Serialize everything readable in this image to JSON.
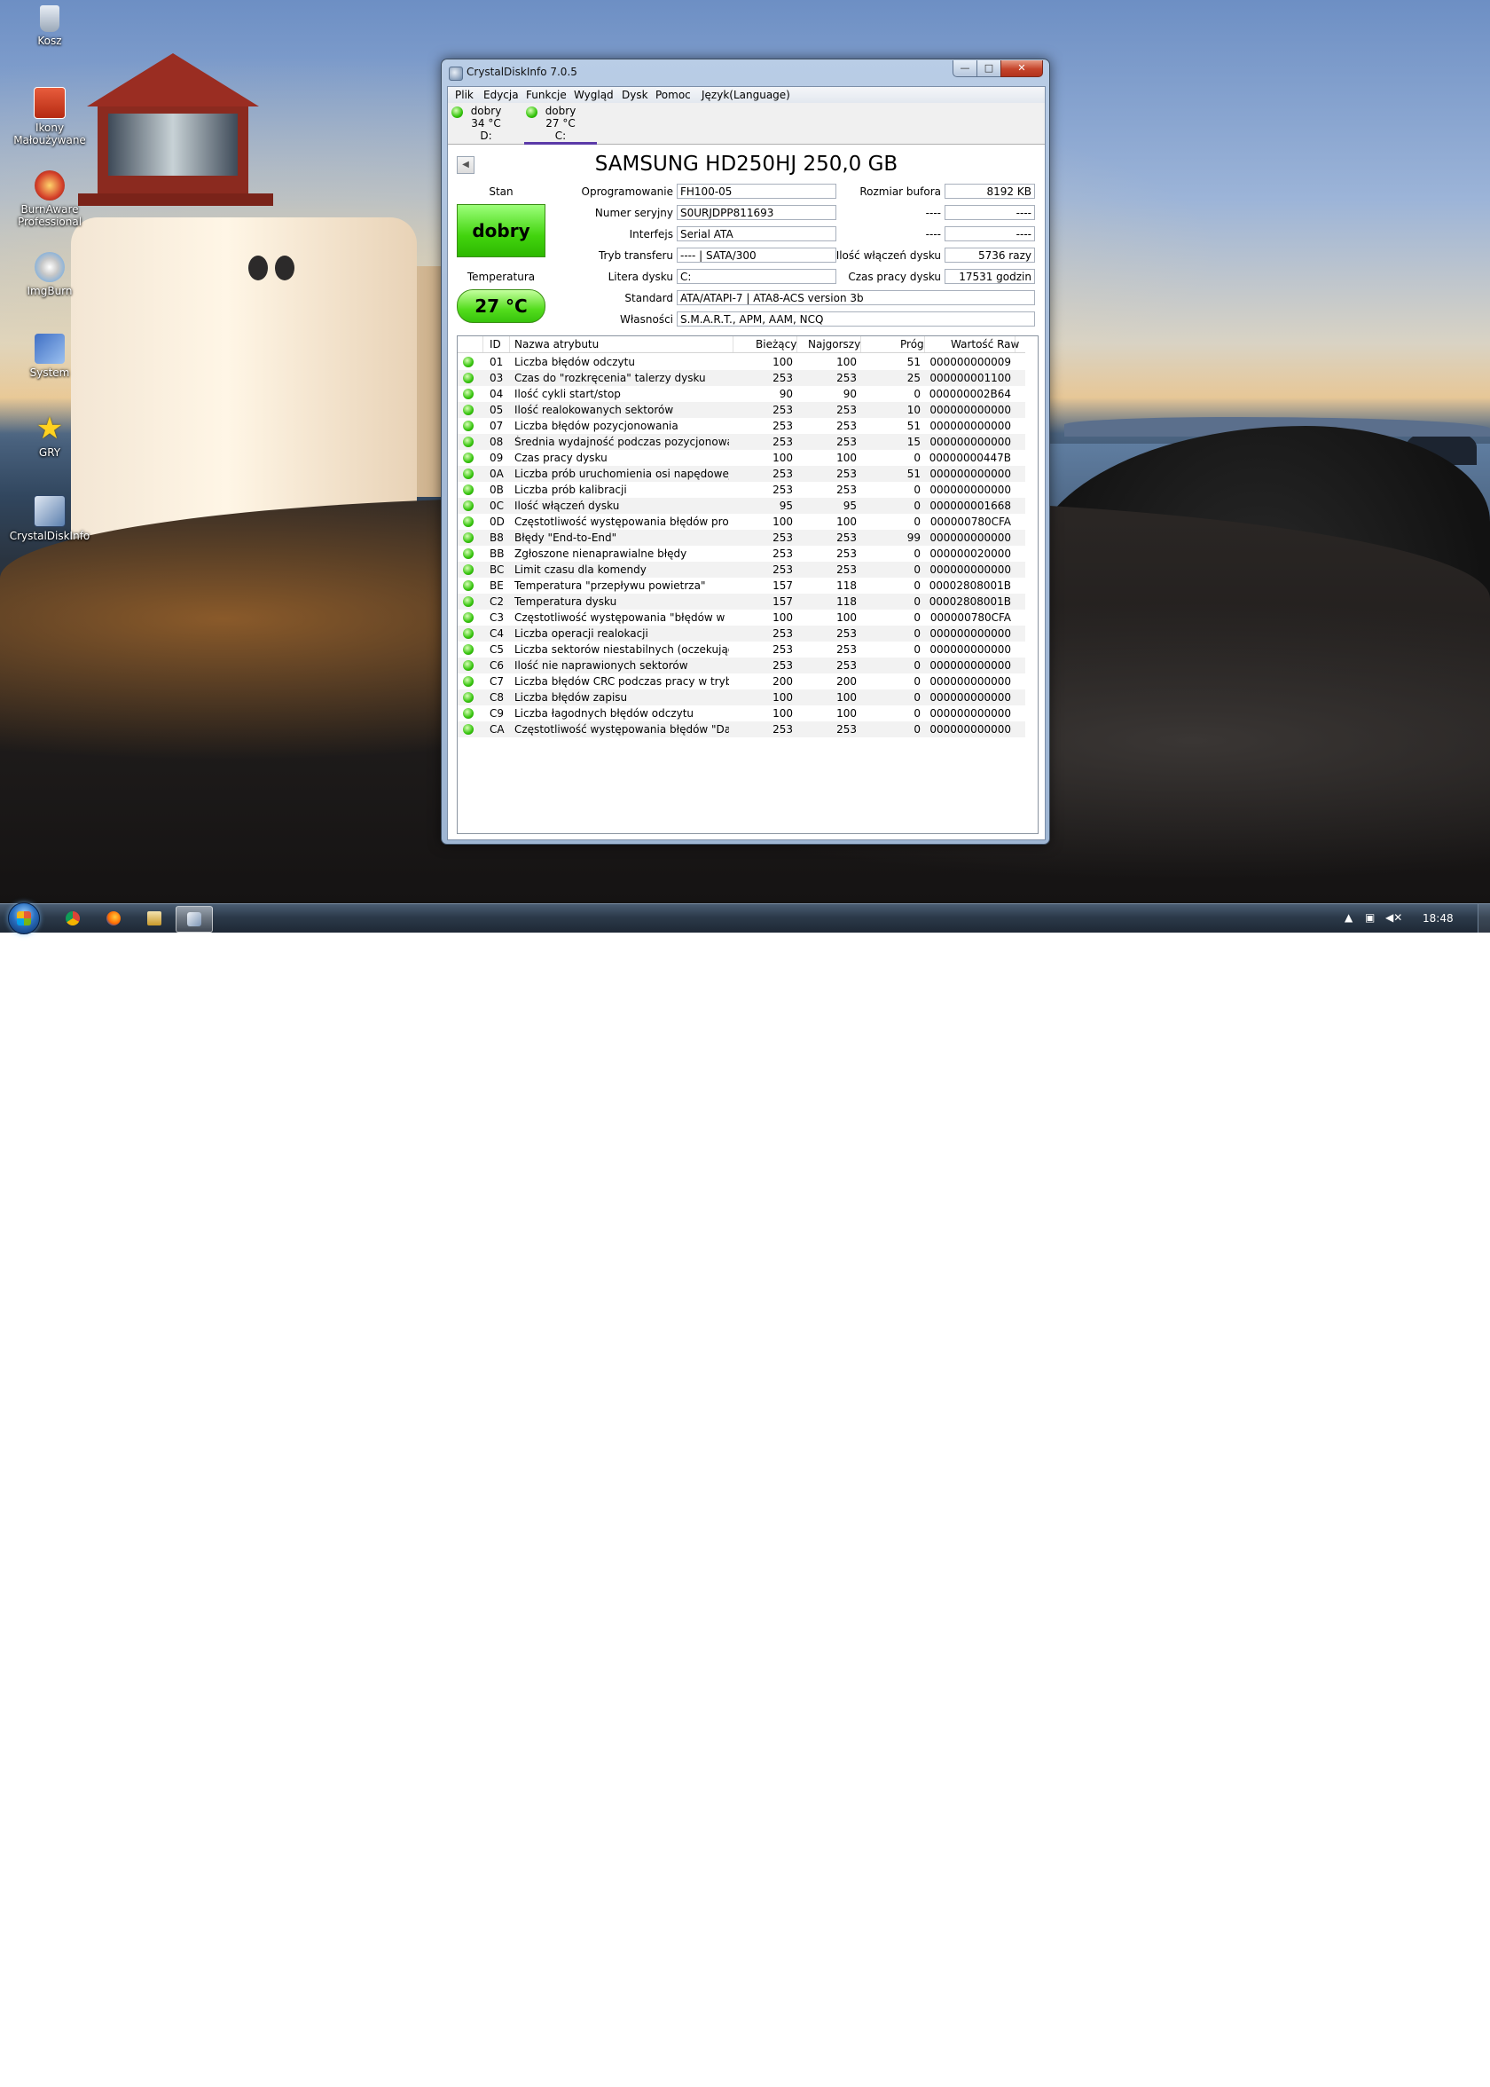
{
  "desktop_icons": [
    {
      "label": "Kosz",
      "icon": "recycle-bin-icon"
    },
    {
      "label": "Ikony Małoużywane",
      "icon": "power-icon"
    },
    {
      "label": "BurnAware Professional",
      "icon": "burnaware-icon"
    },
    {
      "label": "ImgBurn",
      "icon": "imgburn-icon"
    },
    {
      "label": "System",
      "icon": "system-icon"
    },
    {
      "label": "GRY",
      "icon": "star-icon"
    },
    {
      "label": "CrystalDiskInfo",
      "icon": "crystaldiskinfo-icon"
    }
  ],
  "window": {
    "title": "CrystalDiskInfo 7.0.5",
    "controls": {
      "minimize": "—",
      "maximize": "□",
      "close": "✕"
    }
  },
  "menu": [
    "Plik",
    "Edycja",
    "Funkcje",
    "Wygląd",
    "Dysk",
    "Pomoc",
    "Język(Language)"
  ],
  "disks": [
    {
      "status": "dobry",
      "temp": "34 °C",
      "letter": "D:"
    },
    {
      "status": "dobry",
      "temp": "27 °C",
      "letter": "C:"
    }
  ],
  "model_title": "SAMSUNG HD250HJ 250,0 GB",
  "health": {
    "label": "Stan",
    "value": "dobry"
  },
  "temperature": {
    "label": "Temperatura",
    "value": "27 °C"
  },
  "info_left": [
    {
      "label": "Oprogramowanie",
      "value": "FH100-05"
    },
    {
      "label": "Numer seryjny",
      "value": "S0URJDPP811693"
    },
    {
      "label": "Interfejs",
      "value": "Serial ATA"
    },
    {
      "label": "Tryb transferu",
      "value": "---- | SATA/300"
    },
    {
      "label": "Litera dysku",
      "value": "C:"
    }
  ],
  "info_right": [
    {
      "label": "Rozmiar bufora",
      "value": "8192 KB"
    },
    {
      "label": "----",
      "value": "----"
    },
    {
      "label": "----",
      "value": "----"
    },
    {
      "label": "Ilość włączeń dysku",
      "value": "5736 razy"
    },
    {
      "label": "Czas pracy dysku",
      "value": "17531 godzin"
    }
  ],
  "info_wide": [
    {
      "label": "Standard",
      "value": "ATA/ATAPI-7 | ATA8-ACS version 3b"
    },
    {
      "label": "Własności",
      "value": "S.M.A.R.T., APM, AAM, NCQ"
    }
  ],
  "table": {
    "headers": [
      "ID",
      "Nazwa atrybutu",
      "Bieżący",
      "Najgorszy",
      "Próg",
      "Wartość Raw"
    ],
    "rows": [
      [
        "01",
        "Liczba błędów odczytu",
        "100",
        "100",
        "51",
        "000000000009"
      ],
      [
        "03",
        "Czas do \"rozkręcenia\" talerzy dysku",
        "253",
        "253",
        "25",
        "000000001100"
      ],
      [
        "04",
        "Ilość cykli start/stop",
        "90",
        "90",
        "0",
        "000000002B64"
      ],
      [
        "05",
        "Ilość realokowanych sektorów",
        "253",
        "253",
        "10",
        "000000000000"
      ],
      [
        "07",
        "Liczba błędów pozycjonowania",
        "253",
        "253",
        "51",
        "000000000000"
      ],
      [
        "08",
        "Średnia wydajność podczas pozycjonowa...",
        "253",
        "253",
        "15",
        "000000000000"
      ],
      [
        "09",
        "Czas pracy dysku",
        "100",
        "100",
        "0",
        "00000000447B"
      ],
      [
        "0A",
        "Liczba prób uruchomienia osi napędowej...",
        "253",
        "253",
        "51",
        "000000000000"
      ],
      [
        "0B",
        "Liczba prób kalibracji",
        "253",
        "253",
        "0",
        "000000000000"
      ],
      [
        "0C",
        "Ilość włączeń dysku",
        "95",
        "95",
        "0",
        "000000001668"
      ],
      [
        "0D",
        "Częstotliwość występowania błędów prog...",
        "100",
        "100",
        "0",
        "000000780CFA"
      ],
      [
        "B8",
        "Błędy \"End-to-End\"",
        "253",
        "253",
        "99",
        "000000000000"
      ],
      [
        "BB",
        "Zgłoszone nienaprawialne błędy",
        "253",
        "253",
        "0",
        "000000020000"
      ],
      [
        "BC",
        "Limit czasu dla komendy",
        "253",
        "253",
        "0",
        "000000000000"
      ],
      [
        "BE",
        "Temperatura \"przepływu powietrza\"",
        "157",
        "118",
        "0",
        "00002808001B"
      ],
      [
        "C2",
        "Temperatura dysku",
        "157",
        "118",
        "0",
        "00002808001B"
      ],
      [
        "C3",
        "Częstotliwość występowania \"błędów w lo...",
        "100",
        "100",
        "0",
        "000000780CFA"
      ],
      [
        "C4",
        "Liczba operacji realokacji",
        "253",
        "253",
        "0",
        "000000000000"
      ],
      [
        "C5",
        "Liczba sektorów niestabilnych (oczekując...",
        "253",
        "253",
        "0",
        "000000000000"
      ],
      [
        "C6",
        "Ilość nie naprawionych sektorów",
        "253",
        "253",
        "0",
        "000000000000"
      ],
      [
        "C7",
        "Liczba błędów CRC podczas pracy w trybi...",
        "200",
        "200",
        "0",
        "000000000000"
      ],
      [
        "C8",
        "Liczba błędów zapisu",
        "100",
        "100",
        "0",
        "000000000000"
      ],
      [
        "C9",
        "Liczba łagodnych błędów odczytu",
        "100",
        "100",
        "0",
        "000000000000"
      ],
      [
        "CA",
        "Częstotliwość występowania błędów \"Dat...",
        "253",
        "253",
        "0",
        "000000000000"
      ]
    ]
  },
  "taskbar": {
    "start": "start-orb",
    "pinned": [
      "chrome-icon",
      "firefox-icon",
      "media-player-icon",
      "crystaldiskinfo-icon"
    ],
    "tray_icons": [
      "show-hidden-icon",
      "network-icon",
      "volume-muted-icon"
    ],
    "clock": "18:48"
  }
}
